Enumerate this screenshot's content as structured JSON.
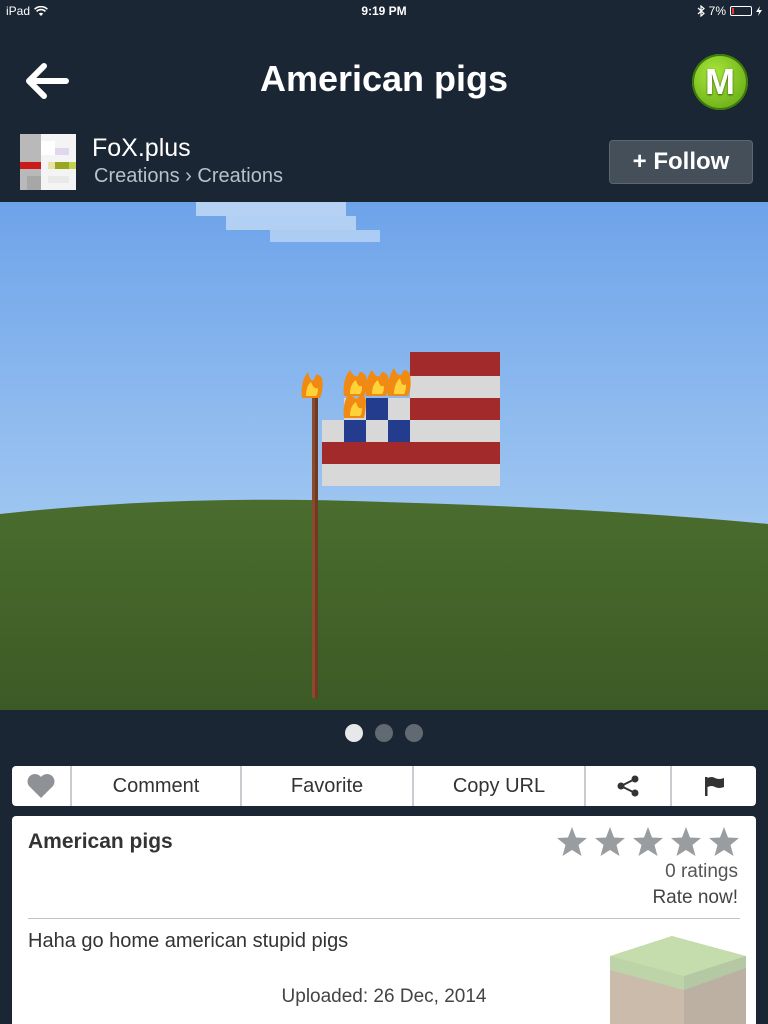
{
  "status_bar": {
    "device": "iPad",
    "time": "9:19 PM",
    "battery": "7%"
  },
  "header": {
    "title": "American pigs",
    "back_icon": "back-arrow-icon",
    "logo_letter": "M"
  },
  "author": {
    "name": "FoX.plus",
    "breadcrumb": "Creations › Creations",
    "follow_label": "+ Follow"
  },
  "gallery": {
    "page_count": 3,
    "current_page": 1
  },
  "actions": {
    "like_icon": "heart-icon",
    "comment_label": "Comment",
    "favorite_label": "Favorite",
    "copy_url_label": "Copy URL",
    "share_icon": "share-icon",
    "flag_icon": "flag-icon"
  },
  "details": {
    "title": "American pigs",
    "stars_filled": 0,
    "stars_total": 5,
    "ratings": "0 ratings",
    "rate_now": "Rate now!",
    "description": "Haha go home american stupid pigs",
    "uploaded": "Uploaded: 26 Dec, 2014"
  },
  "colors": {
    "background": "#1a2633",
    "logo_green": "#6cc01e",
    "star_gray": "#9a9da0"
  }
}
